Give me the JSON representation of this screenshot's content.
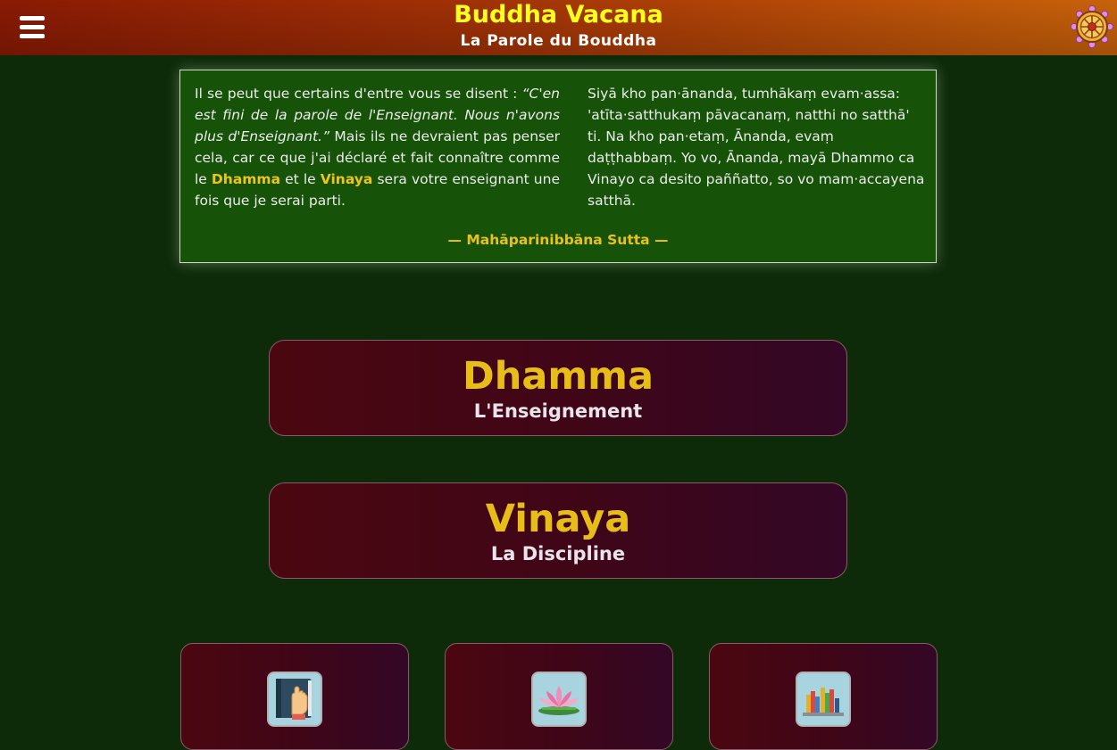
{
  "header": {
    "title": "Buddha Vacana",
    "subtitle": "La Parole du Bouddha",
    "menu_icon": "hamburger-menu-icon",
    "logo_icon": "dhamma-wheel-icon",
    "colors": {
      "title": "#ffff1e",
      "bar_start": "#8a1a04",
      "bar_end": "#c8620a"
    }
  },
  "quote": {
    "fr_part1": "Il se peut que certains d'entre vous se disent : ",
    "fr_italic": "“C'en est fini de la parole de l'Enseignant. Nous n'avons plus d'Enseignant.”",
    "fr_part2": " Mais ils ne devraient pas penser cela, car ce que j'ai déclaré et fait connaître comme le ",
    "fr_dhamma": "Dhamma",
    "fr_part3": " et le ",
    "fr_vinaya": "Vinaya",
    "fr_part4": " sera votre enseignant une fois que je serai parti.",
    "pali": "Siyā kho pan·ānanda, tumhākaṃ evam·assa: 'atīta·satthukaṃ pāvacanaṃ, natthi no satthā' ti. Na kho pan·etaṃ, Ānanda, evaṃ daṭṭhabbaṃ. Yo vo, Ānanda, mayā Dhammo ca Vinayo ca desito paññatto, so vo mam·accayena satthā.",
    "source": "— Mahāparinibbāna Sutta —"
  },
  "buttons": [
    {
      "title": "Dhamma",
      "subtitle": "L'Enseignement"
    },
    {
      "title": "Vinaya",
      "subtitle": "La Discipline"
    }
  ],
  "cards": [
    {
      "icon": "book-hand-icon"
    },
    {
      "icon": "lotus-icon"
    },
    {
      "icon": "bookshelf-icon"
    }
  ],
  "colors": {
    "background": "#0e2b09",
    "quote_box": "#165208",
    "highlight": "#eec51a",
    "button_bg": "#440716"
  }
}
